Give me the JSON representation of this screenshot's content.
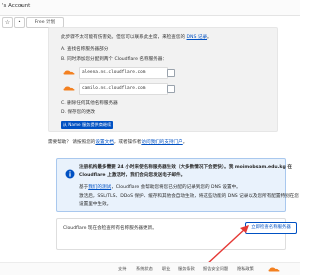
{
  "topbar": {
    "account": "'s Account",
    "caret": "▾"
  },
  "toolbar": {
    "star": "☆",
    "dot": "•",
    "plan": "Free 计划"
  },
  "instructions": {
    "line1_text": "此步骤不太可能有伤害处。但您可以联系此主席，来检查您的 ",
    "line1_link": "DNS 记录",
    "line1_end": "。",
    "step_a": "A. 查找名称服务器部分",
    "step_b": "B. 同时添加您分配到两个 Cloudflare 名称服务器：",
    "nameservers": [
      "aleena.ns.cloudflare.com",
      "camilo.ns.cloudflare.com"
    ],
    "step_c": "C. 删除任何其他名称服务器",
    "step_d": "D. 保存您的更改",
    "bottom_button": "从 Name 服务提供商继续"
  },
  "help": {
    "text1": "需要帮助？ 请按照您的",
    "link1": "设置文档",
    "text2": "，或者操作者",
    "link2": "访问我们的支持门户",
    "text3": "。"
  },
  "alert": {
    "line1": "注册机构最多需要 24 小时来使名称服务器生效（大多数情况下会更快）。我 moimobsam.edu.kg 在",
    "line2": "Cloudflare 上激活时，我们会向您发送电子邮件。",
    "line3_text": "基于",
    "line3_link": "我们的测试",
    "line3_end": "，Cloudflare 会帮助您将您已分配的记录到您的 DNS 设置中。",
    "line4": "激活后，SSL/TLS、DDoS 保护、缓存和其他会自动生效，将这些功能的 DNS 记录以及您所有配置特别在您",
    "line5": "设置里中生效。"
  },
  "action": {
    "prompt": "Cloudflare 现在会检查所有名称服务器更新。",
    "check_button": "立即检查名称服务器"
  },
  "footer": {
    "links": [
      "支持",
      "系统状态",
      "职业",
      "服务条款",
      "报告安全问题",
      "隐私政策"
    ]
  },
  "colors": {
    "link": "#0051c3",
    "arrow": "#e53935",
    "cf_orange": "#f38020"
  }
}
